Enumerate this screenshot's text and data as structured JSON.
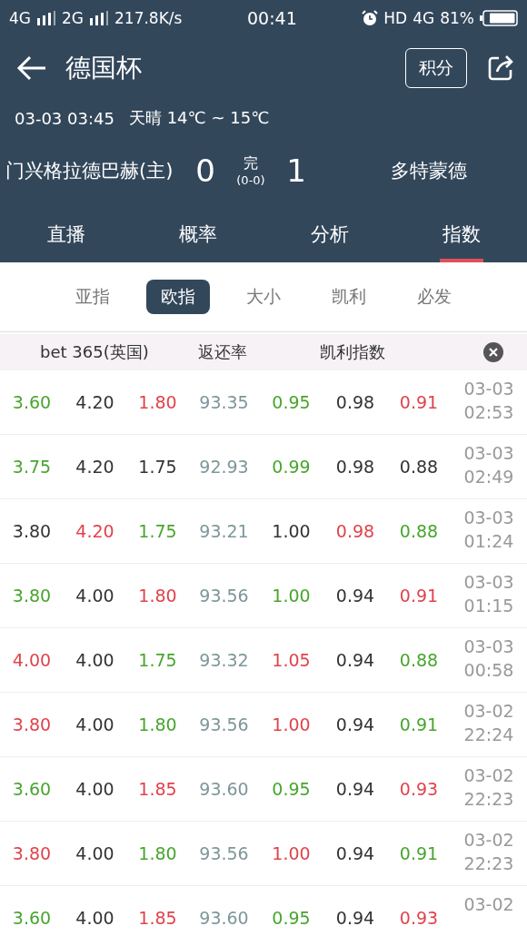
{
  "status_bar": {
    "network_1": "4G",
    "network_2": "2G",
    "speed": "217.8K/s",
    "time": "00:41",
    "hd": "HD",
    "network_3": "4G",
    "battery": "81%"
  },
  "header": {
    "title": "德国杯",
    "points_button": "积分"
  },
  "match": {
    "datetime": "03-03 03:45",
    "weather": "天晴 14℃ ~ 15℃",
    "home": "门兴格拉德巴赫(主)",
    "home_score": "0",
    "status": "完",
    "half_score": "(0-0)",
    "away_score": "1",
    "away": "多特蒙德"
  },
  "tabs": [
    {
      "label": "直播",
      "selected": false
    },
    {
      "label": "概率",
      "selected": false
    },
    {
      "label": "分析",
      "selected": false
    },
    {
      "label": "指数",
      "selected": true
    }
  ],
  "sub_tabs": [
    {
      "label": "亚指",
      "selected": false
    },
    {
      "label": "欧指",
      "selected": true
    },
    {
      "label": "大小",
      "selected": false
    },
    {
      "label": "凯利",
      "selected": false
    },
    {
      "label": "必发",
      "selected": false
    }
  ],
  "table": {
    "bookmaker": "bet 365(英国)",
    "return_rate_header": "返还率",
    "kelly_header": "凯利指数",
    "rows": [
      {
        "odds": [
          {
            "text": "3.60",
            "color": "#47a52d"
          },
          {
            "text": "4.20",
            "color": "#333333"
          },
          {
            "text": "1.80",
            "color": "#e0434b"
          }
        ],
        "return_rate": "93.35",
        "kelly": [
          {
            "text": "0.95",
            "color": "#47a52d"
          },
          {
            "text": "0.98",
            "color": "#333333"
          },
          {
            "text": "0.91",
            "color": "#e0434b"
          }
        ],
        "date": "03-03",
        "time": "02:53"
      },
      {
        "odds": [
          {
            "text": "3.75",
            "color": "#47a52d"
          },
          {
            "text": "4.20",
            "color": "#333333"
          },
          {
            "text": "1.75",
            "color": "#333333"
          }
        ],
        "return_rate": "92.93",
        "kelly": [
          {
            "text": "0.99",
            "color": "#47a52d"
          },
          {
            "text": "0.98",
            "color": "#333333"
          },
          {
            "text": "0.88",
            "color": "#333333"
          }
        ],
        "date": "03-03",
        "time": "02:49"
      },
      {
        "odds": [
          {
            "text": "3.80",
            "color": "#333333"
          },
          {
            "text": "4.20",
            "color": "#e0434b"
          },
          {
            "text": "1.75",
            "color": "#47a52d"
          }
        ],
        "return_rate": "93.21",
        "kelly": [
          {
            "text": "1.00",
            "color": "#333333"
          },
          {
            "text": "0.98",
            "color": "#e0434b"
          },
          {
            "text": "0.88",
            "color": "#47a52d"
          }
        ],
        "date": "03-03",
        "time": "01:24"
      },
      {
        "odds": [
          {
            "text": "3.80",
            "color": "#47a52d"
          },
          {
            "text": "4.00",
            "color": "#333333"
          },
          {
            "text": "1.80",
            "color": "#e0434b"
          }
        ],
        "return_rate": "93.56",
        "kelly": [
          {
            "text": "1.00",
            "color": "#47a52d"
          },
          {
            "text": "0.94",
            "color": "#333333"
          },
          {
            "text": "0.91",
            "color": "#e0434b"
          }
        ],
        "date": "03-03",
        "time": "01:15"
      },
      {
        "odds": [
          {
            "text": "4.00",
            "color": "#e0434b"
          },
          {
            "text": "4.00",
            "color": "#333333"
          },
          {
            "text": "1.75",
            "color": "#47a52d"
          }
        ],
        "return_rate": "93.32",
        "kelly": [
          {
            "text": "1.05",
            "color": "#e0434b"
          },
          {
            "text": "0.94",
            "color": "#333333"
          },
          {
            "text": "0.88",
            "color": "#47a52d"
          }
        ],
        "date": "03-03",
        "time": "00:58"
      },
      {
        "odds": [
          {
            "text": "3.80",
            "color": "#e0434b"
          },
          {
            "text": "4.00",
            "color": "#333333"
          },
          {
            "text": "1.80",
            "color": "#47a52d"
          }
        ],
        "return_rate": "93.56",
        "kelly": [
          {
            "text": "1.00",
            "color": "#e0434b"
          },
          {
            "text": "0.94",
            "color": "#333333"
          },
          {
            "text": "0.91",
            "color": "#47a52d"
          }
        ],
        "date": "03-02",
        "time": "22:24"
      },
      {
        "odds": [
          {
            "text": "3.60",
            "color": "#47a52d"
          },
          {
            "text": "4.00",
            "color": "#333333"
          },
          {
            "text": "1.85",
            "color": "#e0434b"
          }
        ],
        "return_rate": "93.60",
        "kelly": [
          {
            "text": "0.95",
            "color": "#47a52d"
          },
          {
            "text": "0.94",
            "color": "#333333"
          },
          {
            "text": "0.93",
            "color": "#e0434b"
          }
        ],
        "date": "03-02",
        "time": "22:23"
      },
      {
        "odds": [
          {
            "text": "3.80",
            "color": "#e0434b"
          },
          {
            "text": "4.00",
            "color": "#333333"
          },
          {
            "text": "1.80",
            "color": "#47a52d"
          }
        ],
        "return_rate": "93.56",
        "kelly": [
          {
            "text": "1.00",
            "color": "#e0434b"
          },
          {
            "text": "0.94",
            "color": "#333333"
          },
          {
            "text": "0.91",
            "color": "#47a52d"
          }
        ],
        "date": "03-02",
        "time": "22:23"
      },
      {
        "odds": [
          {
            "text": "3.60",
            "color": "#47a52d"
          },
          {
            "text": "4.00",
            "color": "#333333"
          },
          {
            "text": "1.85",
            "color": "#e0434b"
          }
        ],
        "return_rate": "93.60",
        "kelly": [
          {
            "text": "0.95",
            "color": "#47a52d"
          },
          {
            "text": "0.94",
            "color": "#333333"
          },
          {
            "text": "0.93",
            "color": "#e0434b"
          }
        ],
        "date": "03-02"
      }
    ]
  }
}
